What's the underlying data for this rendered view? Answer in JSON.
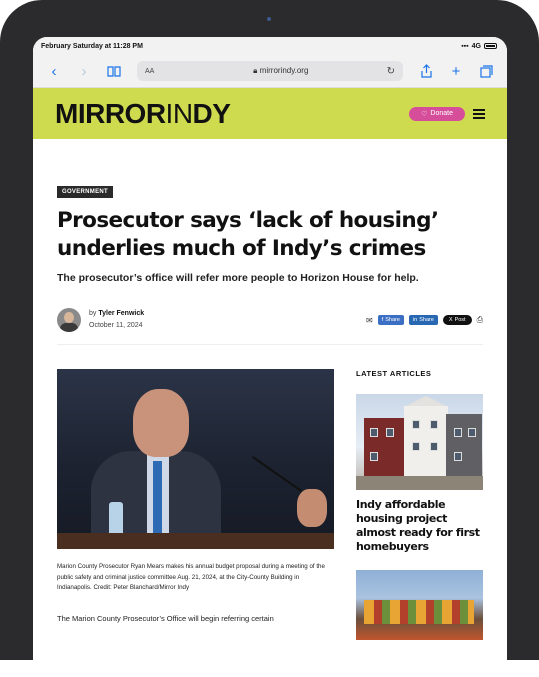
{
  "status_bar": {
    "time": "February Saturday at 11:28 PM",
    "signal": "4G"
  },
  "browser": {
    "aa_label": "AA",
    "url": "mirrorindy.org"
  },
  "site": {
    "logo_bold_1": "MIRROR",
    "logo_thin": "IN",
    "logo_bold_2": "DY",
    "donate_label": "Donate",
    "accent_color": "#cfdb4f",
    "donate_color": "#d64e9a"
  },
  "article": {
    "tag": "GOVERNMENT",
    "headline": "Prosecutor says ‘lack of housing’ underlies much of Indy’s crimes",
    "subhead": "The prosecutor’s office will refer more people to Horizon House for help.",
    "by_prefix": "by",
    "author": "Tyler Fenwick",
    "date": "October 11, 2024",
    "share": {
      "facebook": "Share",
      "linkedin": "Share",
      "x": "Post"
    },
    "caption": "Marion County Prosecutor Ryan Mears makes his annual budget proposal during a meeting of the public safety and criminal justice committee Aug. 21, 2024, at the City-County Building in Indianapolis. Credit: Peter Blanchard/Mirror Indy",
    "body_start": "The Marion County Prosecutor’s Office will begin referring certain"
  },
  "sidebar": {
    "heading": "LATEST ARTICLES",
    "items": [
      {
        "title": "Indy affordable housing project almost ready for first homebuyers"
      }
    ]
  }
}
